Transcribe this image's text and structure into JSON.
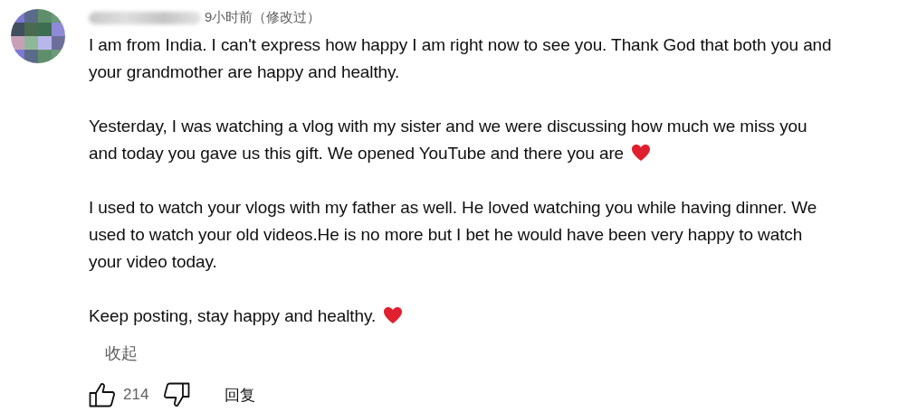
{
  "comment": {
    "time": "9小时前（修改过）",
    "paragraphs": [
      {
        "lines": [
          "I am from India. I can't express how happy I am right now to see you. Thank God that both you and",
          "your grandmother are happy and healthy."
        ],
        "heart": false
      },
      {
        "lines": [
          "Yesterday, I was watching a vlog with my sister and we were discussing how much we miss you",
          "and today you gave us this gift. We opened YouTube and there you are"
        ],
        "heart": true
      },
      {
        "lines": [
          "I used to watch your vlogs with my father as well. He loved watching you while having dinner. We",
          "used to watch your old videos.He is no more but I bet he would have been very happy to watch",
          "your video today."
        ],
        "heart": false
      },
      {
        "lines": [
          "Keep posting, stay happy and healthy."
        ],
        "heart": true
      }
    ],
    "collapse": "收起",
    "likes": "214",
    "reply": "回复"
  }
}
